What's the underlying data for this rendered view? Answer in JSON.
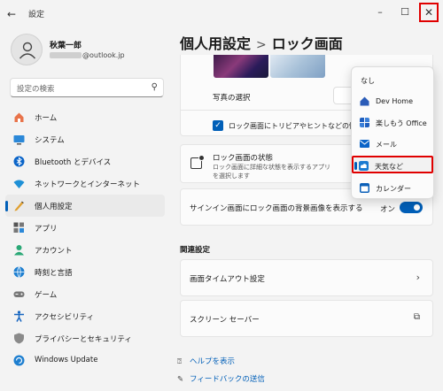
{
  "window": {
    "title": "設定",
    "back": "←",
    "min": "–",
    "max": "☐",
    "close": "✕"
  },
  "user": {
    "name": "秋葉一郎",
    "email_suffix": "@outlook.jp"
  },
  "search": {
    "placeholder": "設定の検索",
    "icon": "search-icon"
  },
  "nav": {
    "items": [
      {
        "label": "ホーム",
        "icon": "home-icon"
      },
      {
        "label": "システム",
        "icon": "monitor-icon"
      },
      {
        "label": "Bluetooth とデバイス",
        "icon": "bluetooth-icon"
      },
      {
        "label": "ネットワークとインターネット",
        "icon": "wifi-icon"
      },
      {
        "label": "個人用設定",
        "icon": "pencil-icon"
      },
      {
        "label": "アプリ",
        "icon": "apps-icon"
      },
      {
        "label": "アカウント",
        "icon": "account-icon"
      },
      {
        "label": "時刻と言語",
        "icon": "globe-icon"
      },
      {
        "label": "ゲーム",
        "icon": "gamepad-icon"
      },
      {
        "label": "アクセシビリティ",
        "icon": "accessibility-icon"
      },
      {
        "label": "プライバシーとセキュリティ",
        "icon": "shield-icon"
      },
      {
        "label": "Windows Update",
        "icon": "update-icon"
      }
    ],
    "active_index": 4
  },
  "header": {
    "parent": "個人用設定",
    "separator": ">",
    "current": "ロック画面"
  },
  "lock": {
    "photo_select_label": "写真の選択",
    "trivia_label": "ロック画面にトリビアやヒントなどの情報を",
    "trivia_checked": true,
    "status_title": "ロック画面の状態",
    "status_desc": "ロック画面に詳細な状態を表示するアプリを選択します",
    "signin_label": "サインイン画面にロック画面の背景画像を表示する",
    "signin_toggle_label": "オン",
    "signin_on": true
  },
  "related": {
    "title": "関連設定",
    "timeout_label": "画面タイムアウト設定",
    "screensaver_label": "スクリーン セーバー"
  },
  "links": {
    "help": "ヘルプを表示",
    "feedback": "フィードバックの送信"
  },
  "dropdown": {
    "items": [
      {
        "label": "なし",
        "icon": ""
      },
      {
        "label": "Dev Home",
        "icon": "dev-home-icon",
        "color": "#e8f0fb"
      },
      {
        "label": "楽しもう Office",
        "icon": "office-icon",
        "color": "#1f5fbf"
      },
      {
        "label": "メール",
        "icon": "mail-icon",
        "color": "#0a64c8"
      },
      {
        "label": "天気など",
        "icon": "weather-icon",
        "color": "#1b7ad0"
      },
      {
        "label": "カレンダー",
        "icon": "calendar-icon",
        "color": "#0a5fb8"
      }
    ],
    "selected_index": 4
  },
  "colors": {
    "accent": "#005fb8",
    "highlight": "#e00000"
  }
}
